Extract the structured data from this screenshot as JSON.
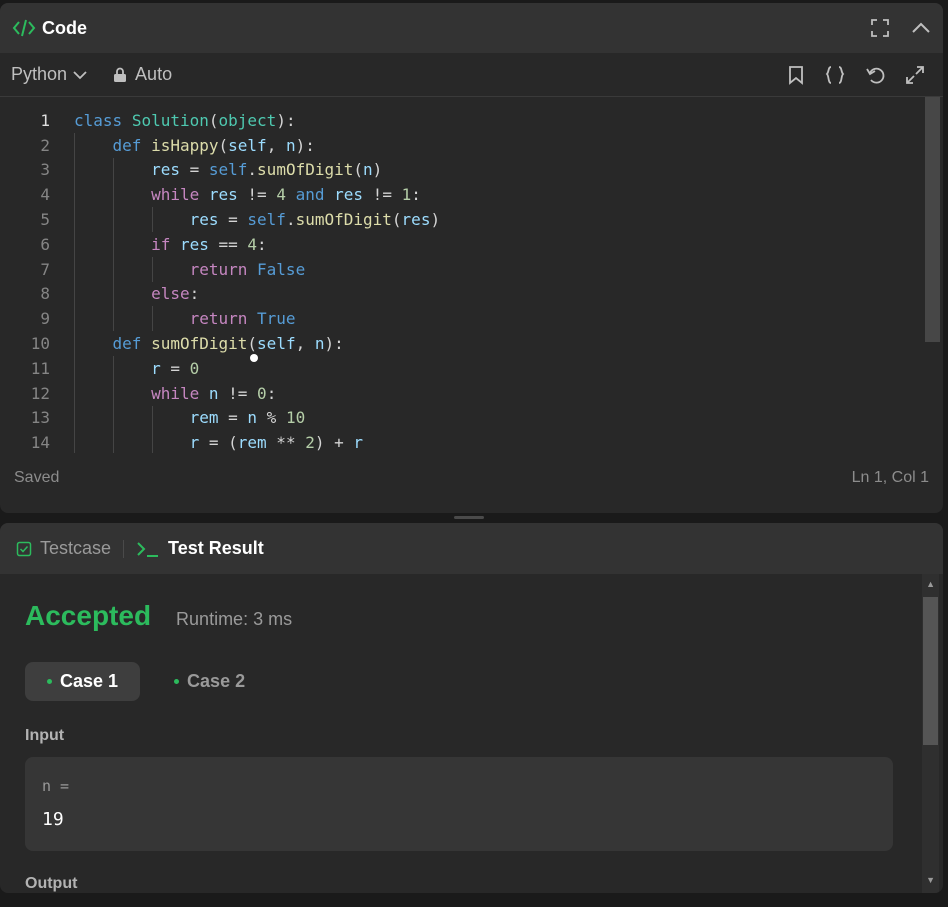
{
  "code_panel": {
    "title": "Code",
    "language": "Python",
    "mode": "Auto",
    "status_left": "Saved",
    "status_right": "Ln 1, Col 1",
    "line_numbers": [
      "1",
      "2",
      "3",
      "4",
      "5",
      "6",
      "7",
      "8",
      "9",
      "10",
      "11",
      "12",
      "13",
      "14"
    ]
  },
  "result_panel": {
    "tab_testcase": "Testcase",
    "tab_result": "Test Result",
    "verdict": "Accepted",
    "runtime": "Runtime: 3 ms",
    "case1": "Case 1",
    "case2": "Case 2",
    "input_label": "Input",
    "input_var": "n =",
    "input_value": "19",
    "output_label": "Output"
  },
  "colors": {
    "accent_green": "#2cbb5d",
    "keyword": "#569cd6",
    "control": "#c586c0",
    "function": "#dcdcaa",
    "number": "#b5cea8"
  }
}
